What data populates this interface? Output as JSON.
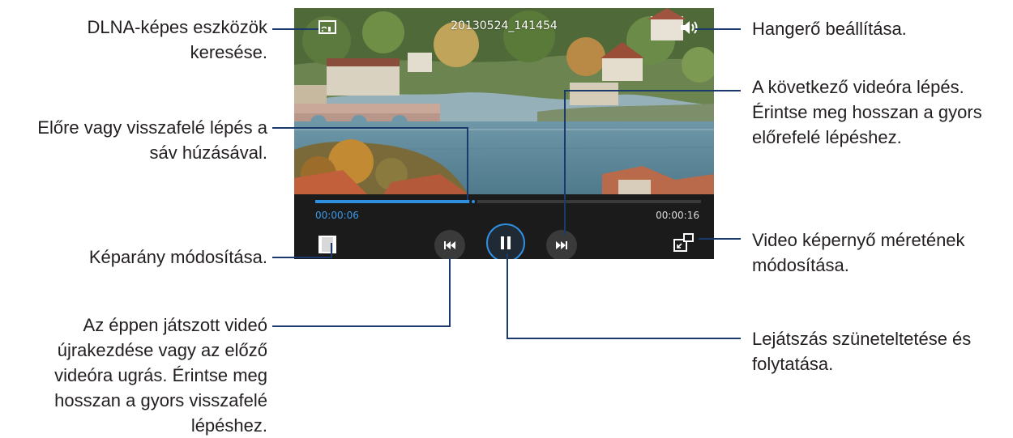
{
  "player": {
    "title": "20130524_141454",
    "elapsed": "00:00:06",
    "total": "00:00:16",
    "progress_fraction": 0.41,
    "icons": {
      "dlna": "dlna-screen-icon",
      "volume": "speaker-icon",
      "aspect": "aspect-ratio-icon",
      "prev": "skip-previous-icon",
      "pause": "pause-icon",
      "next": "skip-next-icon",
      "popup": "popup-screen-icon"
    },
    "colors": {
      "accent": "#2f8fe0",
      "control_bar": "#1b1b1b"
    }
  },
  "annotations": {
    "dlna": "DLNA-képes eszközök\nkeresése.",
    "seek": "Előre vagy visszafelé lépés a\nsáv húzásával.",
    "aspect": "Képarány módosítása.",
    "prev": "Az éppen játszott videó\nújrakezdése vagy az előző\nvideóra ugrás. Érintse meg\nhosszan a gyors visszafelé\nlépéshez.",
    "volume": "Hangerő beállítása.",
    "next": "A következő videóra lépés.\nÉrintse meg hosszan a gyors\nelőrefelé lépéshez.",
    "popup": "Video képernyő méretének\nmódosítása.",
    "pause": "Lejátszás szüneteltetése és\nfolytatása."
  }
}
